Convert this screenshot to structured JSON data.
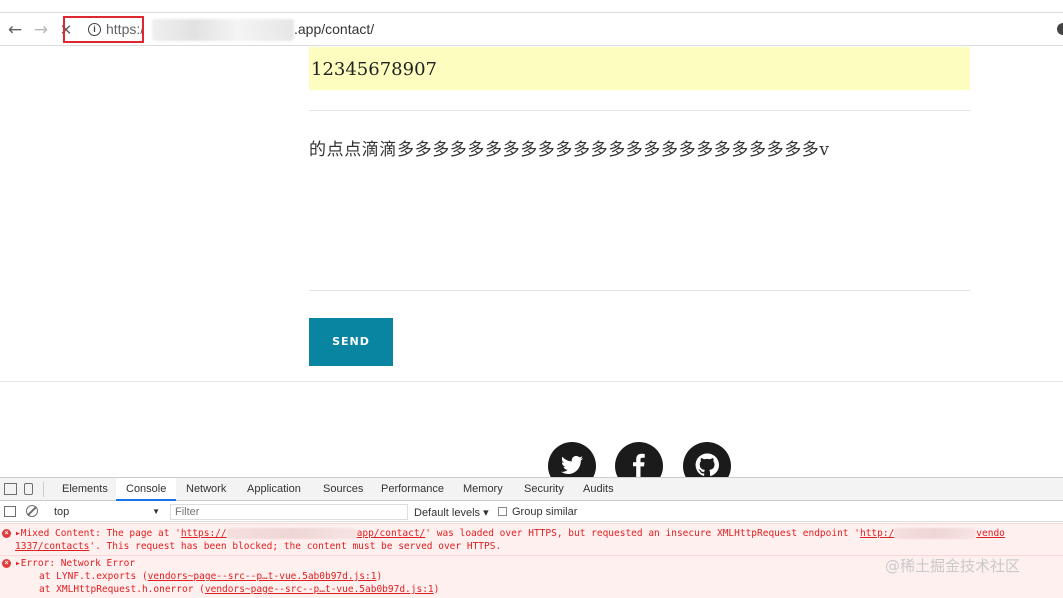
{
  "browser": {
    "url_scheme": "https:/",
    "url_path": ".app/contact/",
    "back_glyph": "←",
    "forward_glyph": "→",
    "stop_glyph": "✕",
    "info_glyph": "i"
  },
  "form": {
    "phone_value": "12345678907",
    "message_value": "的点点滴滴多多多多多多多多多多多多多多多多多多多多多多多多v",
    "send_label": "SEND"
  },
  "devtools": {
    "tabs": [
      "Elements",
      "Console",
      "Network",
      "Application",
      "Sources",
      "Performance",
      "Memory",
      "Security",
      "Audits"
    ],
    "context_value": "top",
    "filter_placeholder": "Filter",
    "levels_label": "Default levels ▾",
    "group_similar_label": "Group similar",
    "messages": {
      "mixed_prefix": "▸Mixed Content: The page at '",
      "mixed_url1_start": "https://",
      "mixed_url1_end": "app/contact/",
      "mixed_mid": "' was loaded over HTTPS, but requested an insecure XMLHttpRequest endpoint '",
      "mixed_url2_start": "http:/",
      "mixed_url2_end": "vendo",
      "mixed_line2_link": "1337/contacts",
      "mixed_line2_rest": "'. This request has been blocked; the content must be served over HTTPS.",
      "error_title": "▸Error: Network Error",
      "stack1_prefix": "at LYNF.t.exports (",
      "stack1_link": "vendors~page--src--p…t-vue.5ab0b97d.js:1",
      "stack1_suffix": ")",
      "stack2_prefix": "at XMLHttpRequest.h.onerror (",
      "stack2_link": "vendors~page--src--p…t-vue.5ab0b97d.js:1",
      "stack2_suffix": ")"
    }
  },
  "watermark": "@稀土掘金技术社区",
  "colors": {
    "send_button": "#0a85a1",
    "phone_field_bg": "#fdfdc0",
    "error_text": "#e02020",
    "url_highlight": "#e0262f"
  },
  "icons": [
    "back-arrow-icon",
    "forward-arrow-icon",
    "stop-icon",
    "info-icon",
    "twitter-icon",
    "facebook-icon",
    "github-icon",
    "inspect-icon",
    "device-toolbar-icon",
    "console-sidebar-icon",
    "clear-console-icon",
    "error-icon"
  ]
}
